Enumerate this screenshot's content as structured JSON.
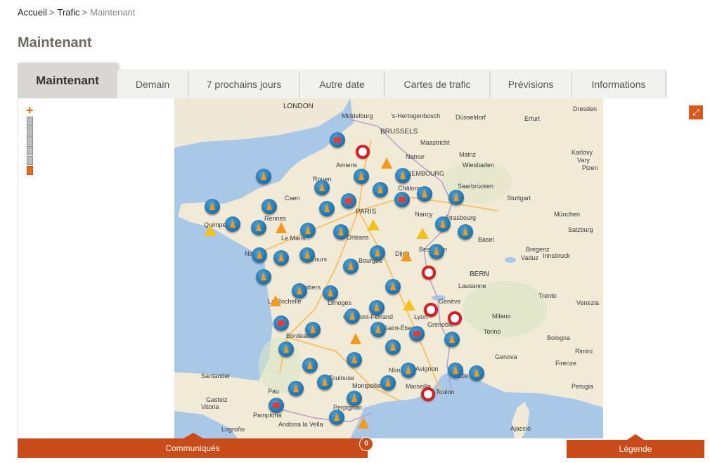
{
  "breadcrumb": {
    "items": [
      "Accueil",
      "Trafic"
    ],
    "current": "Maintenant",
    "separator": ">"
  },
  "page": {
    "title": "Maintenant"
  },
  "tabs": [
    {
      "label": "Maintenant",
      "active": true
    },
    {
      "label": "Demain",
      "active": false
    },
    {
      "label": "7 prochains jours",
      "active": false
    },
    {
      "label": "Autre date",
      "active": false
    },
    {
      "label": "Cartes de trafic",
      "active": false
    },
    {
      "label": "Prévisions",
      "active": false
    },
    {
      "label": "Informations",
      "active": false
    }
  ],
  "map": {
    "zoom": {
      "plus": "+",
      "minus": "−",
      "level_steps": 6,
      "current_level": 6
    },
    "expand_icon": "expand-arrows-icon",
    "colors": {
      "sea": "#a9c7e6",
      "land": "#f1ead6",
      "accent": "#c84b19"
    },
    "places": {
      "london": "LONDON",
      "middelburg": "Middelburg",
      "hertogenbosch": "'s-Hertogenbosch",
      "dusseldorf": "Düsseldorf",
      "dresden": "Dresden",
      "brussels": "BRUSSELS",
      "maastricht": "Maastricht",
      "erfurt": "Erfurt",
      "namur": "Namur",
      "mainz": "Mainz",
      "karlovy": "Karlovy",
      "vary": "Vary",
      "plzen": "Plzen",
      "wiesbaden": "Wiesbaden",
      "amiens": "Amiens",
      "luxembourg": "LUXEMBOURG",
      "rouen": "Rouen",
      "chalons": "Châlons",
      "saarbrucken": "Saarbrücken",
      "caen": "Caen",
      "stuttgart": "Stuttgart",
      "paris": "PARIS",
      "nancy": "Nancy",
      "strasbourg": "Strasbourg",
      "munchen": "München",
      "quimper": "Quimper",
      "rennes": "Rennes",
      "orleans": "Orléans",
      "salzburg": "Salzburg",
      "le_mans": "Le Mans",
      "basel": "Basel",
      "besancon": "Besançon",
      "nantes": "Nantes",
      "tours": "Tours",
      "bourges": "Bourges",
      "dijon": "Dijon",
      "bregenz": "Bregenz",
      "vaduz": "Vaduz",
      "innsbruck": "Innsbruck",
      "bern": "BERN",
      "poitiers": "Poitiers",
      "lausanne": "Lausanne",
      "trento": "Trento",
      "la_rochelle": "La Rochelle",
      "limoges": "Limoges",
      "geneve": "Genève",
      "venezia": "Venezia",
      "clermont_ferrand": "Clermont-Ferrand",
      "lyon": "Lyon",
      "milano": "Milano",
      "grenoble": "Grenoble",
      "saint_etienne": "Saint-Étienne",
      "torino": "Torino",
      "bordeaux": "Bordeaux",
      "bologna": "Bologna",
      "rimini": "Rimini",
      "genova": "Genova",
      "firenze": "Firenze",
      "santander": "Santander",
      "toulouse": "Toulouse",
      "nimes": "Nîmes",
      "avignon": "Avignon",
      "nice": "Nice",
      "montpellier": "Montpellier",
      "pau": "Pau",
      "marseille": "Marseille",
      "toulon": "Toulon",
      "perugia": "Perugia",
      "gasteiz": "Gasteiz",
      "vitoria": "Vitoria",
      "perpignan": "Perpignan",
      "pamplona": "Pamplona",
      "logrono": "Logroño",
      "andorra": "Andorra la Vella",
      "ajaccio": "Ajaccio"
    },
    "markers": [
      {
        "type": "jam-icon"
      },
      {
        "type": "closed-road-icon"
      },
      {
        "type": "roadwork-icon"
      },
      {
        "type": "warning-icon"
      }
    ]
  },
  "bottom": {
    "communiques_label": "Communiqués",
    "communiques_count": "0",
    "legend_label": "Légende"
  }
}
